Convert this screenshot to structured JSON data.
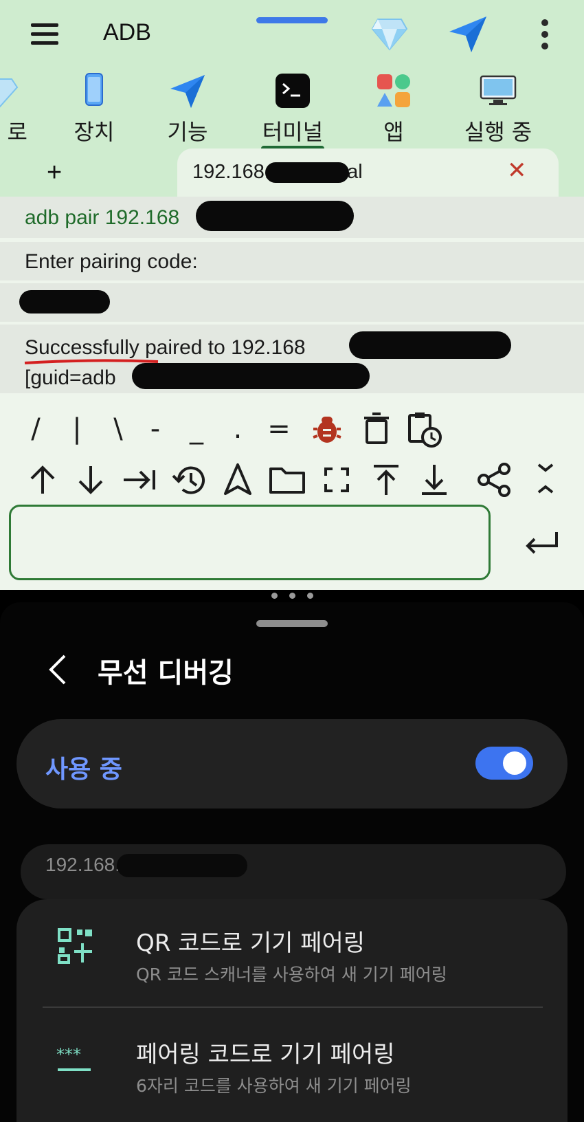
{
  "app": {
    "title": "ADB",
    "menu_icon": "hamburger-menu-icon",
    "diamond_icon": "diamond-icon",
    "send_icon": "send-icon",
    "more_icon": "more-vert-icon"
  },
  "tabs": [
    {
      "label": "로",
      "icon": "diamond-icon"
    },
    {
      "label": "장치",
      "icon": "phone-icon"
    },
    {
      "label": "기능",
      "icon": "send-icon"
    },
    {
      "label": "터미널",
      "icon": "terminal-icon",
      "active": true
    },
    {
      "label": "앱",
      "icon": "apps-icon"
    },
    {
      "label": "실행 중",
      "icon": "monitor-icon"
    }
  ],
  "session_tabs": {
    "add": "+",
    "title": "192.168.  - Terminal",
    "close": "✕"
  },
  "terminal": {
    "lines": [
      {
        "text": "adb pair 192.168",
        "color": "#1f6b2a"
      },
      {
        "text": "Enter pairing code:"
      },
      {
        "text": ""
      },
      {
        "text": "Successfully paired to 192.168",
        "highlight": "Successfully"
      },
      {
        "text": "[guid=adb",
        "suffix": "]"
      }
    ]
  },
  "keys_row1": [
    "/",
    "|",
    "\\",
    "-",
    "_",
    ".",
    "=",
    "bug-icon",
    "trash-icon",
    "clipboard-clock-icon"
  ],
  "keys_row2": [
    "arrow-up-icon",
    "arrow-down-icon",
    "tab-icon",
    "history-icon",
    "navigation-icon",
    "folder-icon",
    "fullscreen-icon",
    "scroll-top-icon",
    "scroll-bottom-icon",
    "share-icon",
    "collapse-icon"
  ],
  "input": {
    "value": "",
    "enter_icon": "enter-icon"
  },
  "settings": {
    "title": "무선 디버깅",
    "toggle_label": "사용 중",
    "toggle_on": true,
    "ip": "192.168.",
    "pair_qr": {
      "title": "QR 코드로 기기 페어링",
      "subtitle": "QR 코드 스캐너를 사용하여 새 기기 페어링",
      "icon": "qr-code-icon"
    },
    "pair_code": {
      "title": "페어링 코드로 기기 페어링",
      "subtitle": "6자리 코드를 사용하여 새 기기 페어링",
      "icon": "password-icon"
    }
  },
  "colors": {
    "top_bg": "#cfeccf",
    "accent_green": "#1f6a35",
    "toggle_blue": "#3d74f0",
    "label_blue": "#6f97ff",
    "close_red": "#c0392b",
    "bug_red": "#b3341f"
  }
}
